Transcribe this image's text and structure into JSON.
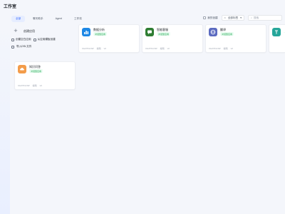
{
  "page": {
    "title": "工作室"
  },
  "tabs": [
    {
      "label": "全部",
      "active": true
    },
    {
      "label": "聊天助手",
      "active": false
    },
    {
      "label": "Agent",
      "active": false
    },
    {
      "label": "工作流",
      "active": false
    }
  ],
  "toolbar": {
    "checkbox_label": "我的创建",
    "tags_select": "全部标签",
    "search_placeholder": "搜索"
  },
  "create": {
    "main_label": "创建应用",
    "blank_label": "创建空白应用",
    "template_label": "从应用模板创建",
    "import_label": "导入DSL文件"
  },
  "cards": [
    {
      "name": "数据分析",
      "tag": "对话型应用",
      "description": "",
      "footer_left": "CHATFLOW",
      "footer_mid": "编辑",
      "footer_right": "v0",
      "accent": "#1e88e5",
      "icon": "chart-icon"
    },
    {
      "name": "智能客服",
      "tag": "对话型应用",
      "description": "",
      "footer_left": "CHATFLOW",
      "footer_mid": "编辑",
      "footer_right": "v0",
      "accent": "#2e7d32",
      "icon": "chat-icon"
    },
    {
      "name": "翻译",
      "tag": "对话型应用",
      "description": "",
      "footer_left": "CHATFLOW",
      "footer_mid": "编辑",
      "footer_right": "v0",
      "accent": "#5c6bc0",
      "icon": "translate-icon"
    },
    {
      "name": "",
      "tag": "",
      "description": "",
      "footer_left": "",
      "footer_mid": "",
      "footer_right": "",
      "accent": "#26a69a",
      "icon": "text-icon"
    },
    {
      "name": "知识问答",
      "tag": "对话型应用",
      "description": "",
      "footer_left": "CHATFLOW",
      "footer_mid": "编辑",
      "footer_right": "v0",
      "accent": "#f39c4a",
      "icon": "cloud-icon"
    }
  ]
}
